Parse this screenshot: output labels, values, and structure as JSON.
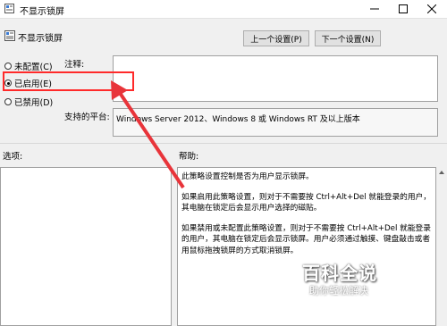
{
  "window": {
    "title": "不显示锁屏"
  },
  "header": {
    "title": "不显示锁屏",
    "prev_label": "上一个设置(P)",
    "next_label": "下一个设置(N)"
  },
  "options": [
    {
      "label": "未配置(C)",
      "selected": false
    },
    {
      "label": "已启用(E)",
      "selected": true
    },
    {
      "label": "已禁用(D)",
      "selected": false
    }
  ],
  "comment": {
    "label": "注释:",
    "value": ""
  },
  "platform": {
    "label": "支持的平台:",
    "value": "Windows Server 2012、Windows 8 或 Windows RT 及以上版本"
  },
  "options_pane": {
    "label": "选项:"
  },
  "help_pane": {
    "label": "帮助:",
    "paragraphs": [
      "此策略设置控制是否为用户显示锁屏。",
      "如果启用此策略设置，则对于不需要按 Ctrl+Alt+Del 就能登录的用户，其电脑在锁定后会显示用户选择的磁贴。",
      "如果禁用或未配置此策略设置，则对于不需要按 Ctrl+Alt+Del 就能登录的用户，其电脑在锁定后会显示锁屏。用户必须通过触摸、键盘敲击或者用鼠标拖拽锁屏的方式取消锁屏。"
    ]
  },
  "watermark": {
    "title": "百科全说",
    "subtitle": "助你轻松解决"
  },
  "colors": {
    "highlight": "#ff2a2a",
    "arrow": "#e8343a"
  }
}
